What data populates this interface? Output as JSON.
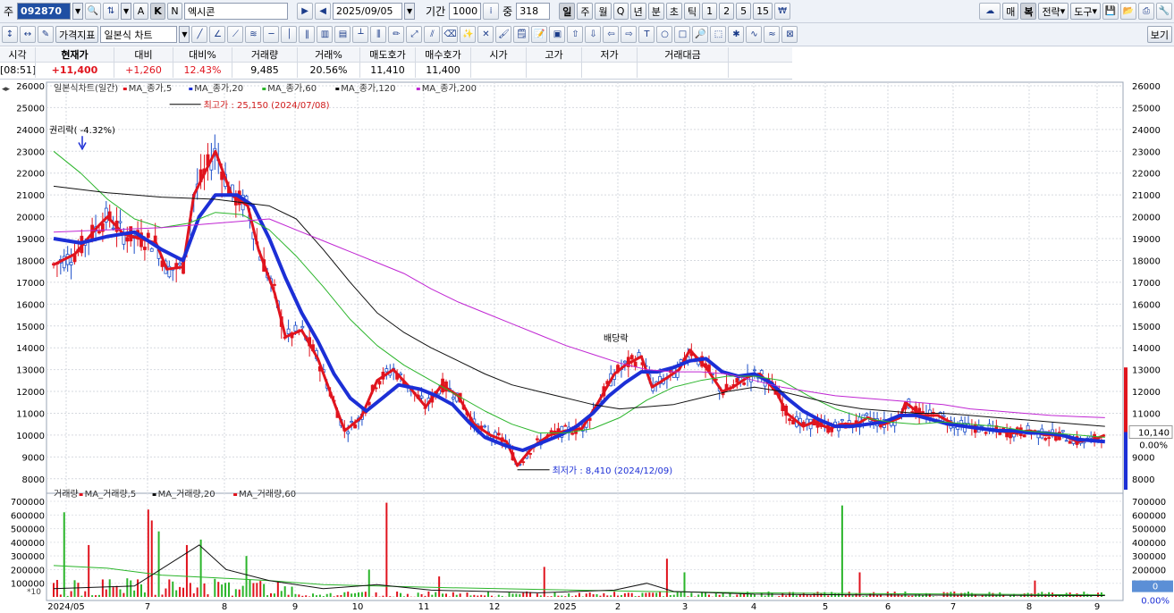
{
  "toolbar1": {
    "market_label": "주",
    "code": "092870",
    "a_label": "A",
    "k_label": "K",
    "n_label": "N",
    "stock_name": "엑시콘",
    "date": "2025/09/05",
    "period_label": "기간",
    "period_value": "1000",
    "mid_label": "중",
    "mid_value": "318",
    "interval_buttons": [
      "일",
      "주",
      "월",
      "Q",
      "년",
      "분",
      "초",
      "틱",
      "1",
      "2",
      "5",
      "15"
    ],
    "right_buttons": [
      "매",
      "복",
      "전략",
      "도구"
    ]
  },
  "toolbar2": {
    "indicator_label": "가격지표",
    "chart_type": "일본식 차트",
    "view_label": "보기"
  },
  "quote": {
    "headers": [
      "시각",
      "현재가",
      "대비",
      "대비%",
      "거래량",
      "거래%",
      "매도호가",
      "매수호가",
      "시가",
      "고가",
      "저가",
      "거래대금"
    ],
    "values": [
      "[08:51]",
      "+11,400",
      "+1,260",
      "12.43%",
      "9,485",
      "20.56%",
      "11,410",
      "11,400",
      "",
      "",
      "",
      ""
    ]
  },
  "price_legend": {
    "title": "일본식차트(일간)",
    "items": [
      "MA_종가,5",
      "MA_종가,20",
      "MA_종가,60",
      "MA_종가,120",
      "MA_종가,200"
    ]
  },
  "volume_legend": {
    "title": "거래량",
    "items": [
      "MA_거래량,5",
      "MA_거래량,20",
      "MA_거래량,60"
    ]
  },
  "annotations": {
    "high": "최고가 : 25,150 (2024/07/08)",
    "low": "최저가 : 8,410 (2024/12/09)",
    "rights": "권리락( -4.32%)",
    "dividend": "배당락"
  },
  "right_panel": {
    "price_tag": "10,140",
    "price_pct": "0.00%",
    "volume_tag": "0",
    "volume_pct": "0.00%",
    "scale_tag": "*10"
  },
  "colors": {
    "up": "#e0141e",
    "down": "#1d4fc9",
    "ma5": "#e0141e",
    "ma20": "#1c2fd6",
    "ma60": "#2bb52b",
    "ma120": "#111111",
    "ma200": "#c026d3"
  },
  "chart_data": {
    "type": "line",
    "title": "일본식차트(일간)",
    "x_labels": [
      "2024/05",
      "7",
      "8",
      "9",
      "10",
      "11",
      "12",
      "2025",
      "2",
      "3",
      "4",
      "5",
      "6",
      "7",
      "8",
      "9"
    ],
    "ylim": [
      7500,
      26000
    ],
    "y_ticks": [
      8000,
      9000,
      10000,
      11000,
      12000,
      13000,
      14000,
      15000,
      16000,
      17000,
      18000,
      19000,
      20000,
      21000,
      22000,
      23000,
      24000,
      25000,
      26000
    ],
    "volume_ylim": [
      0,
      720000
    ],
    "volume_ticks": [
      100000,
      200000,
      300000,
      400000,
      500000,
      600000,
      700000
    ],
    "series": [
      {
        "name": "MA_종가,5",
        "points": [
          [
            0,
            17800
          ],
          [
            0.4,
            18300
          ],
          [
            0.8,
            19500
          ],
          [
            1.0,
            20000
          ],
          [
            1.3,
            19200
          ],
          [
            1.6,
            19000
          ],
          [
            1.9,
            18800
          ],
          [
            2.1,
            17600
          ],
          [
            2.4,
            17700
          ],
          [
            2.6,
            21000
          ],
          [
            2.9,
            22500
          ],
          [
            3.0,
            23000
          ],
          [
            3.3,
            21000
          ],
          [
            3.6,
            20500
          ],
          [
            3.8,
            18500
          ],
          [
            4.1,
            16500
          ],
          [
            4.3,
            14500
          ],
          [
            4.6,
            14800
          ],
          [
            4.9,
            13500
          ],
          [
            5.2,
            11500
          ],
          [
            5.4,
            10200
          ],
          [
            5.7,
            10800
          ],
          [
            6.0,
            12500
          ],
          [
            6.3,
            13000
          ],
          [
            6.6,
            12200
          ],
          [
            6.9,
            11300
          ],
          [
            7.2,
            12300
          ],
          [
            7.5,
            11800
          ],
          [
            7.8,
            10500
          ],
          [
            8.1,
            10000
          ],
          [
            8.4,
            9700
          ],
          [
            8.6,
            8600
          ],
          [
            8.9,
            9500
          ],
          [
            9.2,
            10000
          ],
          [
            9.5,
            10200
          ],
          [
            9.8,
            10300
          ],
          [
            10.1,
            11500
          ],
          [
            10.4,
            12800
          ],
          [
            10.6,
            13200
          ],
          [
            10.9,
            13600
          ],
          [
            11.1,
            12200
          ],
          [
            11.3,
            12500
          ],
          [
            11.6,
            13000
          ],
          [
            11.8,
            13900
          ],
          [
            12.1,
            13100
          ],
          [
            12.4,
            12000
          ],
          [
            12.6,
            12200
          ],
          [
            12.9,
            12700
          ],
          [
            13.1,
            12800
          ],
          [
            13.4,
            12000
          ],
          [
            13.6,
            11000
          ],
          [
            13.9,
            10400
          ],
          [
            14.1,
            10600
          ],
          [
            14.4,
            10300
          ],
          [
            14.6,
            10500
          ],
          [
            14.9,
            10500
          ],
          [
            15.1,
            10800
          ],
          [
            15.4,
            10500
          ],
          [
            15.7,
            10800
          ],
          [
            15.8,
            11500
          ],
          [
            16.1,
            10900
          ],
          [
            16.4,
            10900
          ],
          [
            16.7,
            10500
          ],
          [
            16.9,
            10400
          ],
          [
            17.2,
            10300
          ],
          [
            17.5,
            10200
          ],
          [
            17.8,
            10100
          ],
          [
            18.1,
            10200
          ],
          [
            18.4,
            10000
          ],
          [
            18.7,
            10000
          ],
          [
            19.0,
            9700
          ],
          [
            19.3,
            9800
          ],
          [
            19.5,
            10000
          ]
        ]
      },
      {
        "name": "MA_종가,20",
        "points": [
          [
            0,
            19000
          ],
          [
            0.5,
            18800
          ],
          [
            1.0,
            19100
          ],
          [
            1.5,
            19300
          ],
          [
            2.0,
            18500
          ],
          [
            2.4,
            18000
          ],
          [
            2.7,
            20000
          ],
          [
            3.0,
            21000
          ],
          [
            3.4,
            21000
          ],
          [
            3.7,
            20500
          ],
          [
            4.0,
            19000
          ],
          [
            4.3,
            17200
          ],
          [
            4.6,
            15600
          ],
          [
            4.9,
            14300
          ],
          [
            5.2,
            12800
          ],
          [
            5.5,
            11700
          ],
          [
            5.8,
            11100
          ],
          [
            6.1,
            11700
          ],
          [
            6.4,
            12300
          ],
          [
            6.8,
            12100
          ],
          [
            7.1,
            11800
          ],
          [
            7.4,
            11400
          ],
          [
            7.7,
            10600
          ],
          [
            8.0,
            9900
          ],
          [
            8.4,
            9500
          ],
          [
            8.7,
            9300
          ],
          [
            9.0,
            9600
          ],
          [
            9.4,
            10000
          ],
          [
            9.7,
            10400
          ],
          [
            10.0,
            11000
          ],
          [
            10.3,
            11800
          ],
          [
            10.6,
            12400
          ],
          [
            10.9,
            12900
          ],
          [
            11.2,
            12900
          ],
          [
            11.5,
            13100
          ],
          [
            11.8,
            13400
          ],
          [
            12.1,
            13500
          ],
          [
            12.4,
            12900
          ],
          [
            12.7,
            12700
          ],
          [
            13.0,
            12800
          ],
          [
            13.3,
            12400
          ],
          [
            13.6,
            11700
          ],
          [
            13.9,
            11100
          ],
          [
            14.2,
            10700
          ],
          [
            14.5,
            10400
          ],
          [
            14.8,
            10400
          ],
          [
            15.1,
            10500
          ],
          [
            15.4,
            10600
          ],
          [
            15.7,
            10900
          ],
          [
            16.0,
            10900
          ],
          [
            16.3,
            10700
          ],
          [
            16.6,
            10500
          ],
          [
            16.9,
            10400
          ],
          [
            17.2,
            10300
          ],
          [
            17.5,
            10200
          ],
          [
            17.8,
            10200
          ],
          [
            18.1,
            10100
          ],
          [
            18.4,
            10100
          ],
          [
            18.7,
            10000
          ],
          [
            19.0,
            9800
          ],
          [
            19.5,
            9700
          ]
        ]
      },
      {
        "name": "MA_종가,60",
        "points": [
          [
            0,
            23000
          ],
          [
            0.5,
            22000
          ],
          [
            1.0,
            20800
          ],
          [
            1.5,
            19900
          ],
          [
            2.0,
            19500
          ],
          [
            2.5,
            19700
          ],
          [
            3.0,
            20200
          ],
          [
            3.5,
            20100
          ],
          [
            4.0,
            19400
          ],
          [
            4.5,
            18200
          ],
          [
            5.0,
            16800
          ],
          [
            5.5,
            15300
          ],
          [
            6.0,
            14100
          ],
          [
            6.5,
            13200
          ],
          [
            7.0,
            12500
          ],
          [
            7.5,
            11800
          ],
          [
            8.0,
            11100
          ],
          [
            8.5,
            10500
          ],
          [
            9.0,
            10100
          ],
          [
            9.5,
            10100
          ],
          [
            10.0,
            10300
          ],
          [
            10.5,
            10800
          ],
          [
            11.0,
            11600
          ],
          [
            11.5,
            12200
          ],
          [
            12.0,
            12500
          ],
          [
            12.5,
            12700
          ],
          [
            13.0,
            12700
          ],
          [
            13.5,
            12500
          ],
          [
            14.0,
            11800
          ],
          [
            14.5,
            11200
          ],
          [
            15.0,
            10800
          ],
          [
            15.5,
            10600
          ],
          [
            16.0,
            10500
          ],
          [
            16.5,
            10600
          ],
          [
            17.0,
            10500
          ],
          [
            17.5,
            10400
          ],
          [
            18.0,
            10200
          ],
          [
            18.5,
            10100
          ],
          [
            19.0,
            10000
          ],
          [
            19.5,
            9900
          ]
        ]
      },
      {
        "name": "MA_종가,120",
        "points": [
          [
            0,
            21400
          ],
          [
            1.0,
            21100
          ],
          [
            2.0,
            20900
          ],
          [
            3.0,
            20800
          ],
          [
            4.0,
            20500
          ],
          [
            4.5,
            19900
          ],
          [
            5.0,
            18500
          ],
          [
            5.5,
            17000
          ],
          [
            6.0,
            15600
          ],
          [
            6.5,
            14700
          ],
          [
            7.0,
            14000
          ],
          [
            7.5,
            13400
          ],
          [
            8.0,
            12800
          ],
          [
            8.5,
            12300
          ],
          [
            9.0,
            12000
          ],
          [
            9.5,
            11700
          ],
          [
            10.0,
            11400
          ],
          [
            10.5,
            11200
          ],
          [
            11.0,
            11300
          ],
          [
            11.5,
            11400
          ],
          [
            12.0,
            11700
          ],
          [
            12.5,
            12000
          ],
          [
            13.0,
            12200
          ],
          [
            13.5,
            12000
          ],
          [
            14.0,
            11700
          ],
          [
            14.5,
            11400
          ],
          [
            15.0,
            11200
          ],
          [
            15.5,
            11100
          ],
          [
            16.0,
            11000
          ],
          [
            16.5,
            11000
          ],
          [
            17.0,
            10900
          ],
          [
            17.5,
            10800
          ],
          [
            18.0,
            10700
          ],
          [
            18.5,
            10600
          ],
          [
            19.0,
            10500
          ],
          [
            19.5,
            10400
          ]
        ]
      },
      {
        "name": "MA_종가,200",
        "points": [
          [
            0,
            19300
          ],
          [
            1.0,
            19400
          ],
          [
            2.0,
            19500
          ],
          [
            3.0,
            19700
          ],
          [
            4.0,
            19900
          ],
          [
            4.5,
            19400
          ],
          [
            5.0,
            18900
          ],
          [
            5.5,
            18400
          ],
          [
            6.0,
            17900
          ],
          [
            6.5,
            17400
          ],
          [
            7.0,
            16700
          ],
          [
            7.5,
            16100
          ],
          [
            8.0,
            15600
          ],
          [
            8.5,
            15100
          ],
          [
            9.0,
            14600
          ],
          [
            9.5,
            14100
          ],
          [
            10.0,
            13700
          ],
          [
            10.5,
            13300
          ],
          [
            11.0,
            13000
          ],
          [
            11.5,
            12900
          ],
          [
            12.0,
            12900
          ],
          [
            12.5,
            12800
          ],
          [
            13.0,
            12500
          ],
          [
            13.5,
            12200
          ],
          [
            14.0,
            12000
          ],
          [
            14.5,
            11800
          ],
          [
            15.0,
            11700
          ],
          [
            15.5,
            11600
          ],
          [
            16.0,
            11500
          ],
          [
            16.5,
            11400
          ],
          [
            17.0,
            11200
          ],
          [
            17.5,
            11100
          ],
          [
            18.0,
            11000
          ],
          [
            18.5,
            10900
          ],
          [
            19.0,
            10850
          ],
          [
            19.5,
            10800
          ]
        ]
      }
    ]
  }
}
